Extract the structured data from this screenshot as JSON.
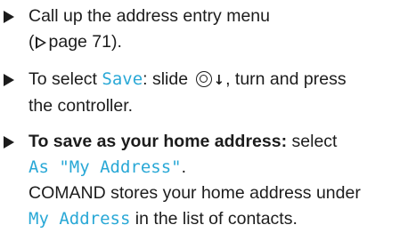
{
  "steps": [
    {
      "line1": "Call up the address entry menu",
      "ref_open": "(",
      "ref_page": "page 71).",
      "ref_icon": "page-reference-triangle-icon"
    },
    {
      "prefix": "To select ",
      "screen_text": "Save",
      "mid": ": slide ",
      "controller_icon": "controller-icon",
      "arrow_icon": "down-arrow-icon",
      "arrow_glyph": "↓",
      "suffix": ", turn and press",
      "line2": "the controller."
    },
    {
      "bold_label": "To save as your home address:",
      "after_bold": " select",
      "screen_text": "As \"My Address\"",
      "after_screen": ".",
      "line3": "COMAND stores your home address under",
      "screen_text2": "My Address",
      "line4_rest": " in the list of contacts."
    }
  ],
  "colors": {
    "text": "#1c1c1c",
    "screen_text": "#29a8d6"
  }
}
